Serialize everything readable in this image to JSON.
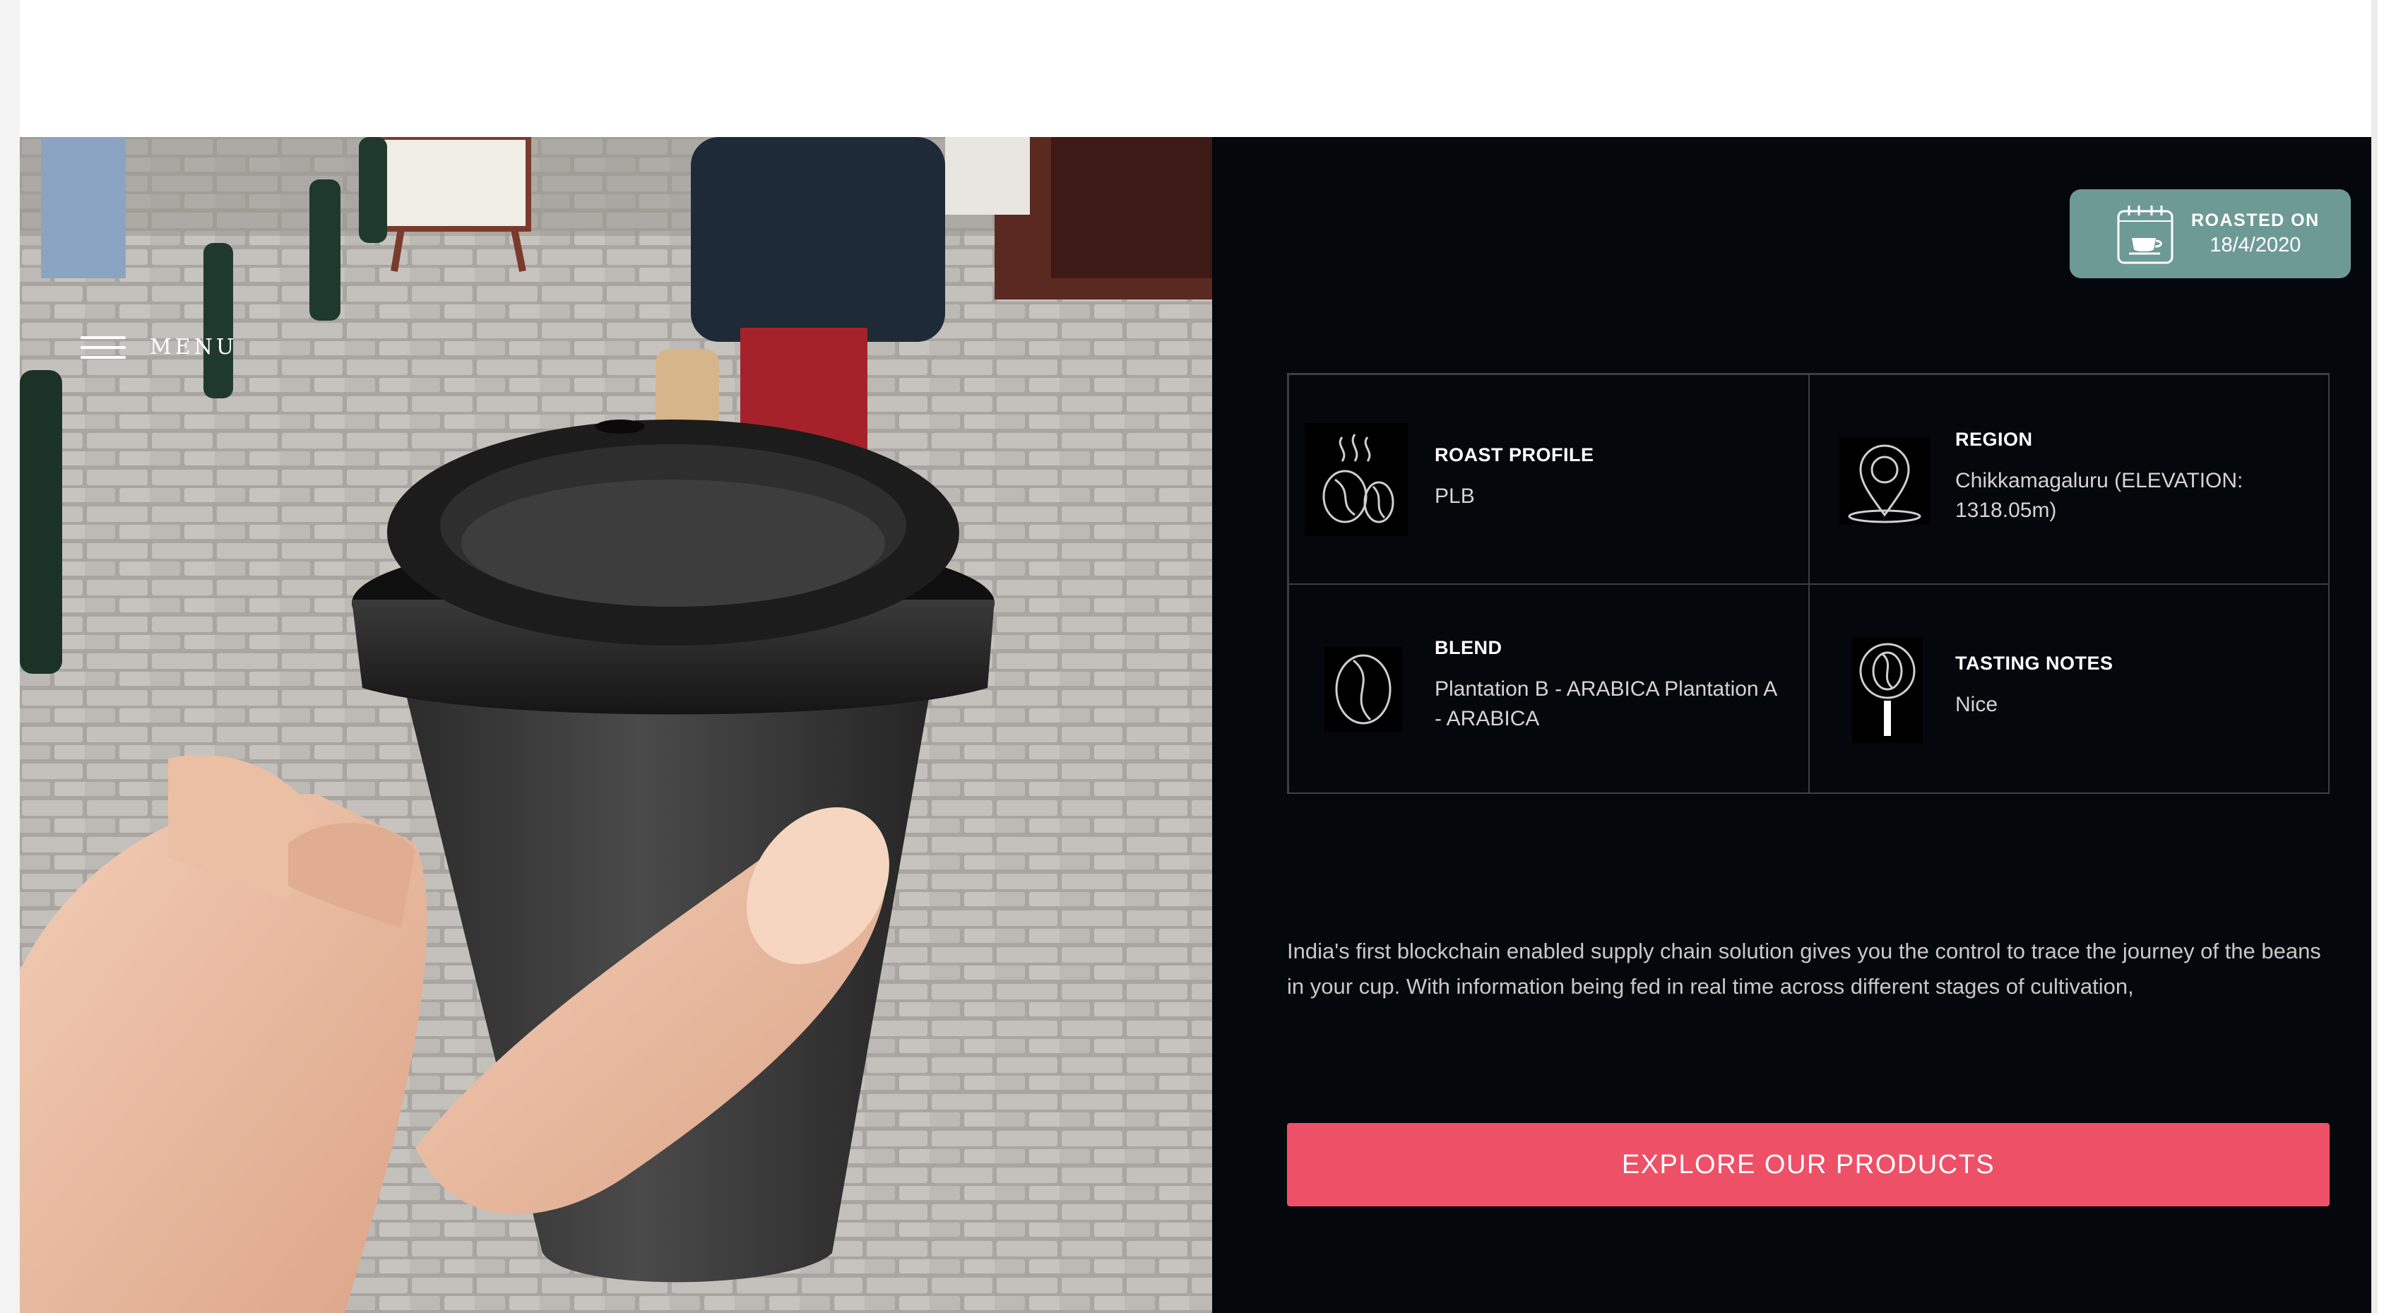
{
  "nav": {
    "menu_label": "MENU",
    "menu_icon": "hamburger-icon"
  },
  "hero_image": {
    "subject": "hand holding black takeaway coffee cup on cobblestone street"
  },
  "roast_badge": {
    "label": "ROASTED ON",
    "date": "18/4/2020",
    "icon": "calendar-cup-icon",
    "color": "#6e9a95"
  },
  "details": {
    "roast_profile": {
      "title": "ROAST PROFILE",
      "value": "PLB",
      "icon": "steaming-beans-icon"
    },
    "region": {
      "title": "REGION",
      "value": "Chikkamagaluru (ELEVATION: 1318.05m)",
      "icon": "location-pin-icon"
    },
    "blend": {
      "title": "BLEND",
      "value": "Plantation B - ARABICA Plantation A - ARABICA",
      "icon": "coffee-bean-icon"
    },
    "tasting_notes": {
      "title": "TASTING NOTES",
      "value": "Nice",
      "icon": "bean-magnifier-icon"
    }
  },
  "description": "India's first blockchain enabled supply chain solution gives you the control to trace the journey of the beans in your cup. With information being fed in real time across different stages of cultivation,",
  "cta": {
    "label": "EXPLORE OUR PRODUCTS",
    "color": "#ee5067"
  },
  "theme": {
    "panel_bg": "#04070b",
    "grid_line": "#3b3f45"
  }
}
